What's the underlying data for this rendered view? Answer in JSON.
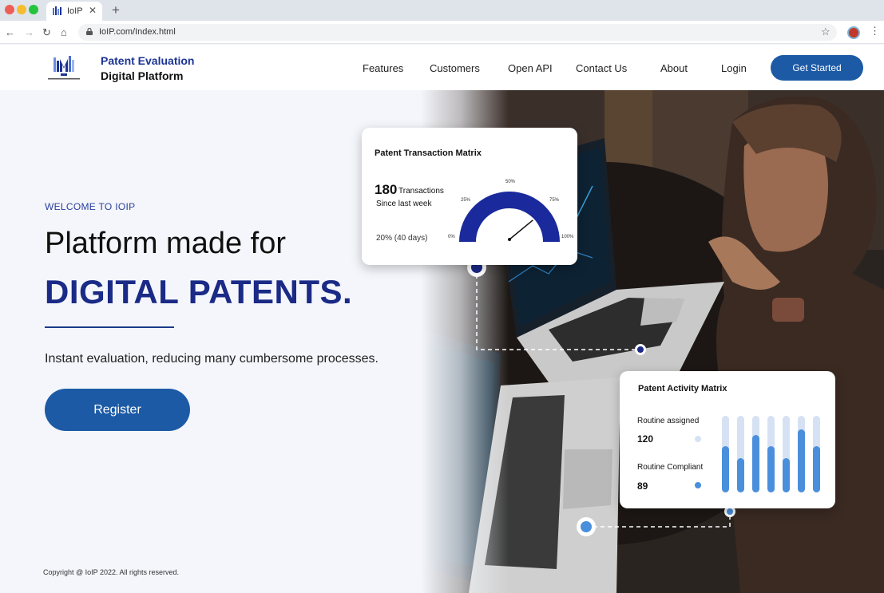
{
  "browser": {
    "tab_title": "IoIP",
    "tab_close": "✕",
    "new_tab": "+",
    "url": "IoIP.com/Index.html"
  },
  "header": {
    "brand_line1": "Patent Evaluation",
    "brand_line2": "Digital Platform",
    "nav": [
      "Features",
      "Customers",
      "Open API",
      "Contact Us",
      "About",
      "Login"
    ],
    "cta": "Get Started"
  },
  "hero": {
    "eyebrow": "WELCOME TO IOIP",
    "heading_line1": "Platform made for",
    "heading_line2": "DIGITAL PATENTS.",
    "subheading": "Instant evaluation, reducing many cumbersome processes.",
    "register": "Register"
  },
  "transaction_card": {
    "title": "Patent Transaction Matrix",
    "count": "180",
    "count_label": "Transactions",
    "period": "Since last week",
    "change": "20% (40 days)",
    "gauge_ticks": [
      "0%",
      "25%",
      "50%",
      "75%",
      "100%"
    ],
    "gauge_value": 0.78
  },
  "activity_card": {
    "title": "Patent Activity Matrix",
    "assigned_label": "Routine assigned",
    "assigned_value": "120",
    "compliant_label": "Routine Compliant",
    "compliant_value": "89",
    "bar_levels": [
      0.6,
      0.45,
      0.75,
      0.6,
      0.45,
      0.82,
      0.6
    ]
  },
  "footer": {
    "copyright": "Copyright @ IoIP 2022. All rights reserved."
  },
  "colors": {
    "brand": "#1c3494",
    "button": "#1c5aa6",
    "gauge": "#1a2a9c",
    "bar_fill": "#4a8fdc",
    "bar_track": "#d6e2f3"
  }
}
